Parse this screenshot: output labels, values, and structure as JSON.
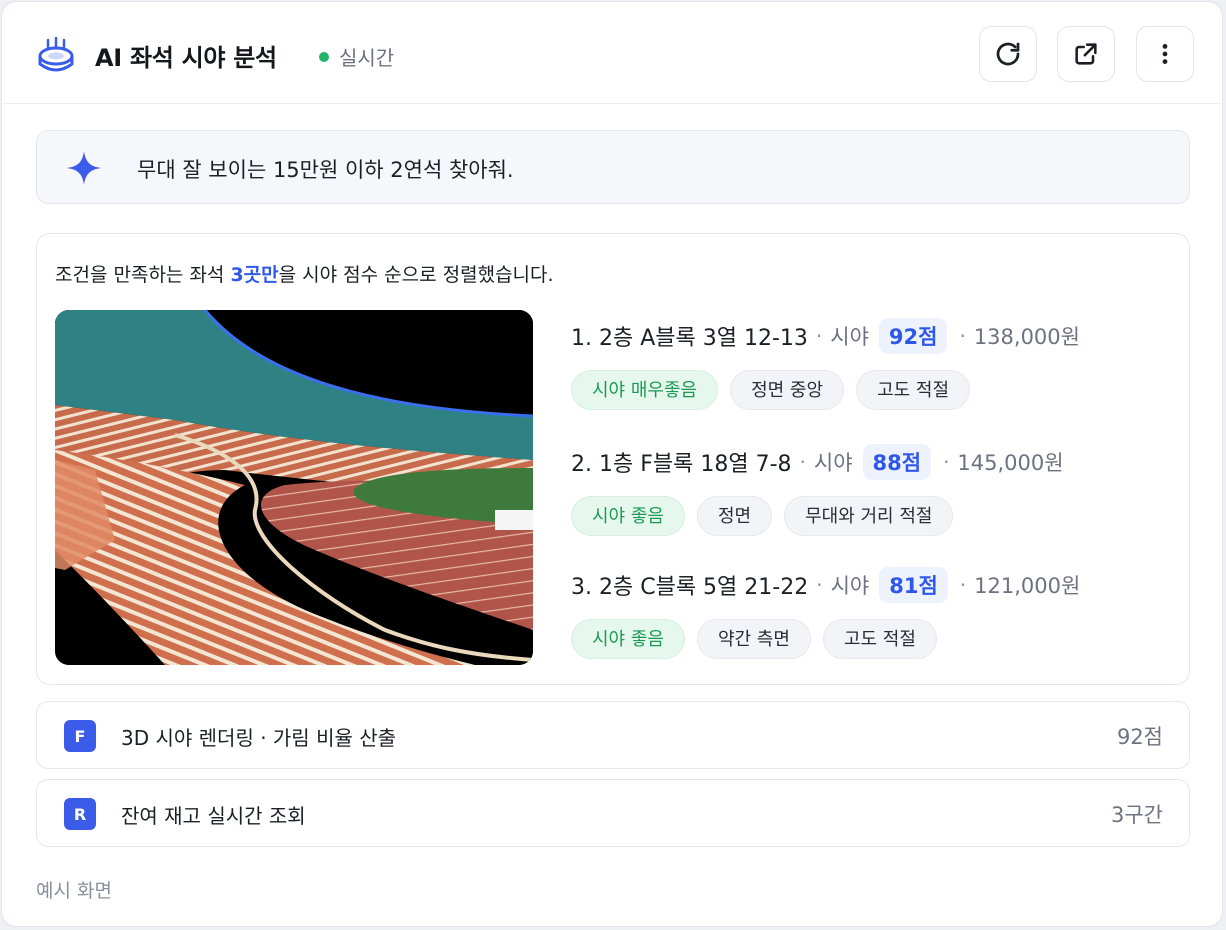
{
  "header": {
    "title": "AI 좌석 시야 분석",
    "status_text": "실시간",
    "status_color": "#22b566",
    "logo_icon": "stadium-icon",
    "buttons": [
      {
        "icon": "refresh-icon"
      },
      {
        "icon": "external-link-icon"
      },
      {
        "icon": "more-vertical-icon"
      }
    ]
  },
  "prompt": {
    "icon": "sparkle-icon",
    "text": "무대 잘 보이는 15만원 이하 2연석 찾아줘."
  },
  "result": {
    "summary_prefix": "조건을 만족하는 좌석 ",
    "summary_highlight": "3곳만",
    "summary_suffix": "을 시야 점수 순으로 정렬했습니다.",
    "accent_color": "#2f58e8",
    "seats": [
      {
        "name": "1. 2층 A블록 3열 12-13",
        "view_label": "시야",
        "score": "92점",
        "price": "138,000원",
        "tags": [
          {
            "label": "시야 매우좋음",
            "type": "good"
          },
          {
            "label": "정면 중앙",
            "type": "neutral"
          },
          {
            "label": "고도 적절",
            "type": "neutral"
          }
        ]
      },
      {
        "name": "2. 1층 F블록 18열 7-8",
        "view_label": "시야",
        "score": "88점",
        "price": "145,000원",
        "tags": [
          {
            "label": "시야 좋음",
            "type": "good"
          },
          {
            "label": "정면",
            "type": "neutral"
          },
          {
            "label": "무대와 거리 적절",
            "type": "neutral"
          }
        ]
      },
      {
        "name": "3. 2층 C블록 5열 21-22",
        "view_label": "시야",
        "score": "81점",
        "price": "121,000원",
        "tags": [
          {
            "label": "시야 좋음",
            "type": "good"
          },
          {
            "label": "약간 측면",
            "type": "neutral"
          },
          {
            "label": "고도 적절",
            "type": "neutral"
          }
        ]
      }
    ]
  },
  "tools": [
    {
      "badge": "F",
      "label": "3D 시야 렌더링 · 가림 비율 산출",
      "value": "92점"
    },
    {
      "badge": "R",
      "label": "잔여 재고 실시간 조회",
      "value": "3구간"
    }
  ],
  "footer": {
    "text": "예시 화면"
  }
}
